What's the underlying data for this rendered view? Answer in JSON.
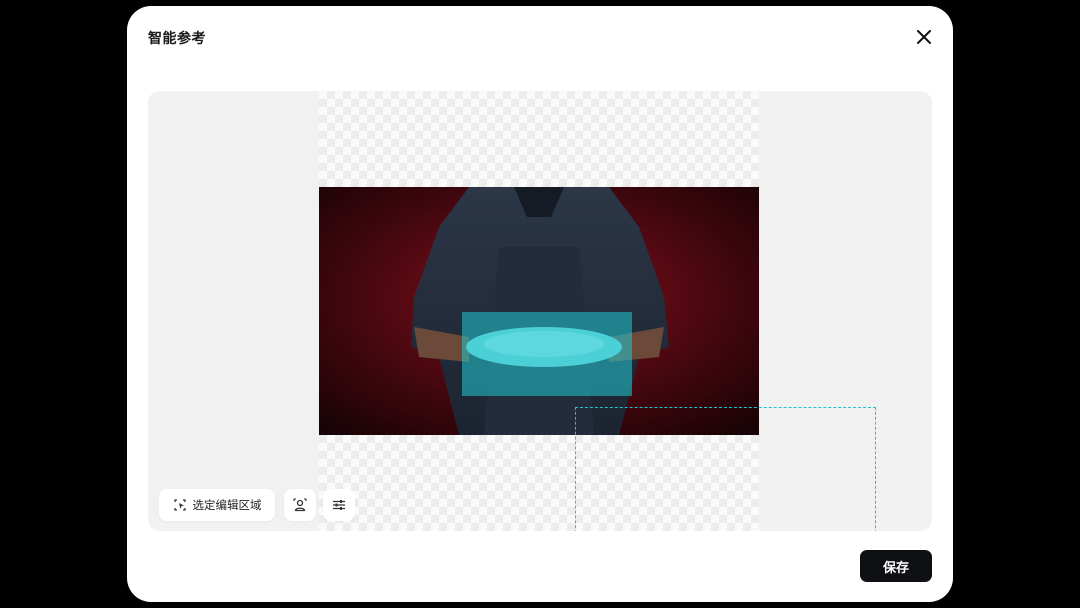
{
  "dialog": {
    "title": "智能参考",
    "close_icon": "close-icon"
  },
  "toolbar": {
    "select_region_label": "选定编辑区域",
    "select_region_icon": "select-region-icon",
    "person_icon": "person-icon",
    "adjust_icon": "sliders-icon"
  },
  "footer": {
    "save_label": "保存"
  },
  "colors": {
    "highlight": "#1fc3d0",
    "save_button": "#0f1013",
    "canvas_bg": "#f1f1f1"
  }
}
